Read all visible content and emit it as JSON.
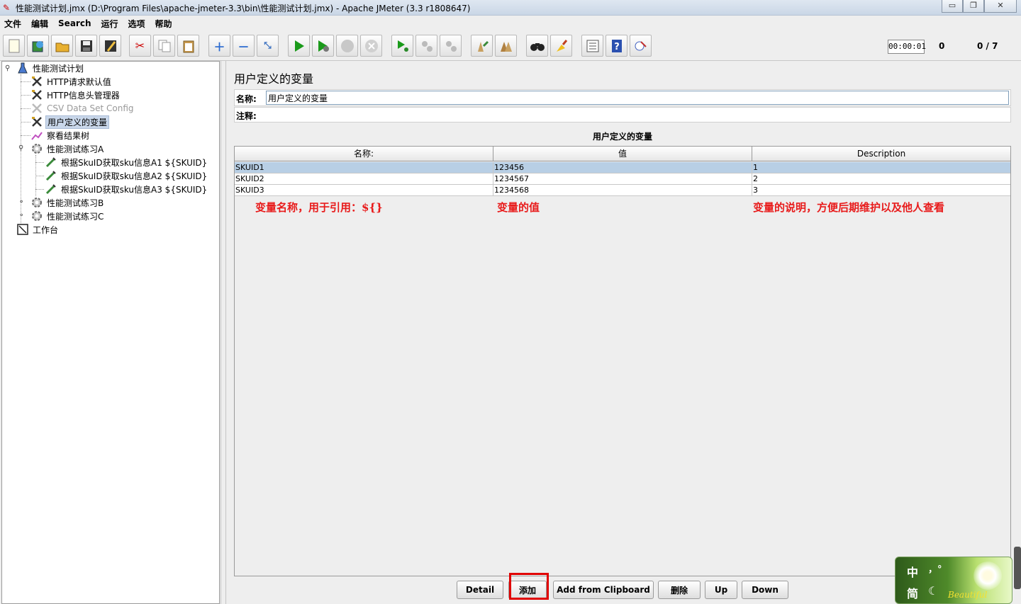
{
  "window": {
    "title": "性能测试计划.jmx (D:\\Program Files\\apache-jmeter-3.3\\bin\\性能测试计划.jmx) - Apache JMeter (3.3 r1808647)",
    "minimize": "▭",
    "maximize": "❐",
    "close": "✕"
  },
  "menu": [
    "文件",
    "编辑",
    "Search",
    "运行",
    "选项",
    "帮助"
  ],
  "status": {
    "timer": "00:00:01",
    "error_count": "0",
    "threads": "0 / 7"
  },
  "tree": {
    "root": "性能测试计划",
    "items": [
      {
        "label": "HTTP请求默认值"
      },
      {
        "label": "HTTP信息头管理器"
      },
      {
        "label": "CSV Data Set Config"
      },
      {
        "label": "用户定义的变量"
      },
      {
        "label": "察看结果树"
      },
      {
        "label": "性能测试练习A"
      },
      {
        "label": "根据SkuID获取sku信息A1 ${SKUID}"
      },
      {
        "label": "根据SkuID获取sku信息A2 ${SKUID}"
      },
      {
        "label": "根据SkuID获取sku信息A3 ${SKUID}"
      },
      {
        "label": "性能测试练习B"
      },
      {
        "label": "性能测试练习C"
      },
      {
        "label": "工作台"
      }
    ]
  },
  "main": {
    "panel_title": "用户定义的变量",
    "name_label": "名称:",
    "name_value": "用户定义的变量",
    "comment_label": "注释:",
    "table_title": "用户定义的变量",
    "columns": [
      "名称:",
      "值",
      "Description"
    ],
    "rows": [
      [
        "SKUID1",
        "123456",
        "1"
      ],
      [
        "SKUID2",
        "1234567",
        "2"
      ],
      [
        "SKUID3",
        "1234568",
        "3"
      ]
    ],
    "notes": [
      "变量名称，用于引用：${}",
      "变量的值",
      "变量的说明，方便后期维护以及他人查看"
    ],
    "buttons": [
      "Detail",
      "添加",
      "Add from Clipboard",
      "删除",
      "Up",
      "Down"
    ]
  },
  "ime": {
    "zh": "中",
    "punct": "，°",
    "simplified": "简",
    "moon": "☾",
    "brand": "Beautiful"
  }
}
